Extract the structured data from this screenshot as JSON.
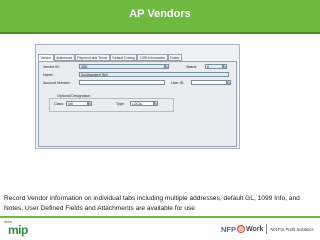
{
  "slide": {
    "title": "AP Vendors",
    "description": "Record Vendor information on individual tabs including multiple addresses, default GL, 1099 Info, and Notes. User Defined Fields and Attachments are available for use"
  },
  "form": {
    "tabs": [
      "Vendor",
      "Addresses",
      "Payment and Terms",
      "Default Coding",
      "1099 Information",
      "Notes"
    ],
    "labels": {
      "vendor_id": "Vendor ID:",
      "status": "Status:",
      "name": "Name:",
      "account_number": "Account Number:",
      "user_id": "User ID:",
      "optional_designation": "Optional Designation",
      "class": "Class:",
      "type": "Type:"
    },
    "values": {
      "vendor_id": "SBE",
      "status": "A",
      "name": "Southwestern Bell",
      "account_number": "",
      "user_id": "",
      "class": "Util",
      "type": "LOCAL"
    }
  },
  "footer": {
    "mip_small": "Abila",
    "mip_big": "mip",
    "nfp_word": "NFP",
    "nfp_at": "@",
    "nfp_work": "Work",
    "nfp_tag": "Not For Profit Solutions"
  },
  "colors": {
    "header_green": "#6fb940",
    "field_highlight": "#d6f2f4"
  }
}
